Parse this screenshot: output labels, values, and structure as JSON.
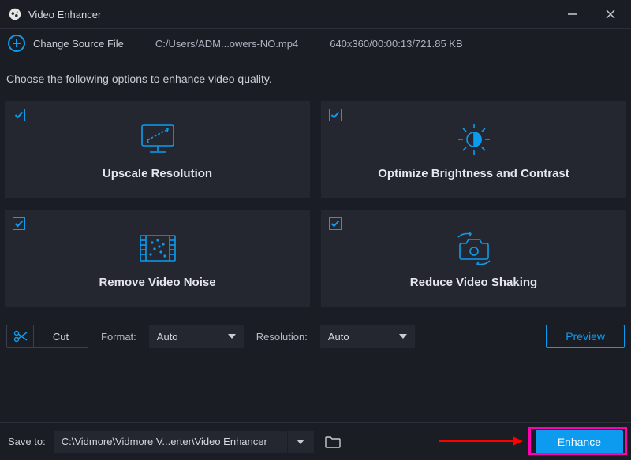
{
  "window": {
    "title": "Video Enhancer"
  },
  "source": {
    "change_label": "Change Source File",
    "path": "C:/Users/ADM...owers-NO.mp4",
    "meta": "640x360/00:00:13/721.85 KB"
  },
  "instruction": "Choose the following options to enhance video quality.",
  "cards": {
    "upscale": "Upscale Resolution",
    "brightness": "Optimize Brightness and Contrast",
    "noise": "Remove Video Noise",
    "shaking": "Reduce Video Shaking"
  },
  "controls": {
    "cut_label": "Cut",
    "format_label": "Format:",
    "format_value": "Auto",
    "resolution_label": "Resolution:",
    "resolution_value": "Auto",
    "preview_label": "Preview"
  },
  "footer": {
    "save_to_label": "Save to:",
    "save_path": "C:\\Vidmore\\Vidmore V...erter\\Video Enhancer",
    "enhance_label": "Enhance"
  },
  "colors": {
    "accent": "#0d9bf0",
    "highlight": "#ff00b3",
    "arrow": "#ff0000"
  }
}
